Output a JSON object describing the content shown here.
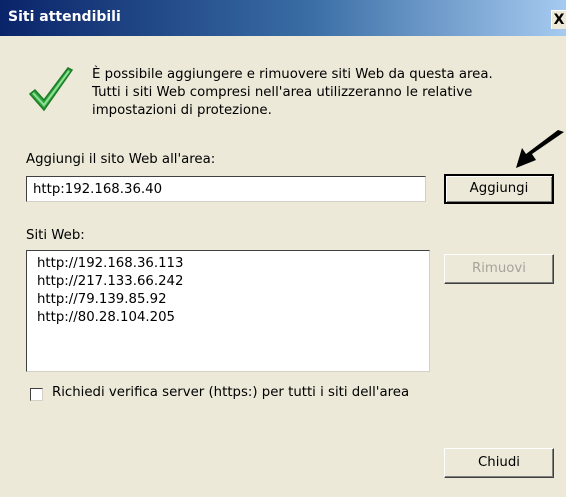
{
  "window": {
    "title": "Siti attendibili",
    "close_label": "X"
  },
  "info": {
    "text": "È possibile aggiungere e rimuovere siti Web da questa area.\nTutti i siti Web compresi nell'area utilizzeranno le relative\nimpostazioni di protezione."
  },
  "add": {
    "label": "Aggiungi il sito Web all'area:",
    "input_value": "http:192.168.36.40",
    "button_label": "Aggiungi"
  },
  "sites": {
    "label": "Siti Web:",
    "items": [
      "http://192.168.36.113",
      "http://217.133.66.242",
      "http://79.139.85.92",
      "http://80.28.104.205"
    ],
    "remove_label": "Rimuovi"
  },
  "verify": {
    "label": "Richiedi verifica server (https:) per tutti i siti dell'area",
    "checked": false
  },
  "footer": {
    "close_button_label": "Chiudi"
  },
  "colors": {
    "title_bar_start": "#0a246a",
    "title_bar_end": "#a6caf0",
    "dialog_bg": "#ece9d8",
    "check_green": "#2fa83a"
  },
  "icons": {
    "status": "checkmark-icon",
    "annotation": "arrow-icon"
  }
}
